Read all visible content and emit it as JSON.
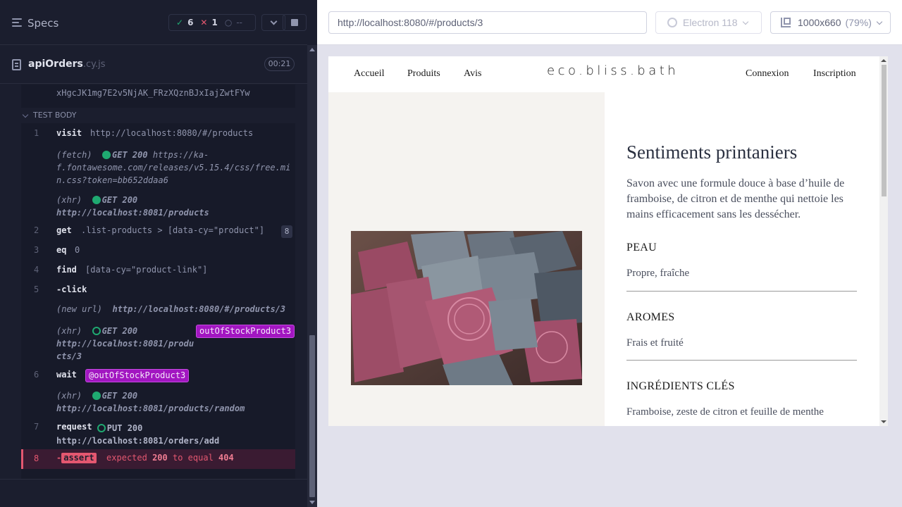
{
  "reporter": {
    "specs_label": "Specs",
    "stats": {
      "passed": "6",
      "failed": "1",
      "pending": "--"
    },
    "spec_file": {
      "name": "apiOrders",
      "ext": ".cy.js"
    },
    "duration": "00:21",
    "token_tail": "xHgcJK1mg7E2v5NjAK_FRzXQznBJxIajZwtFYw",
    "test_body_label": "TEST BODY",
    "commands": [
      {
        "num": "1",
        "name": "visit",
        "msg": "http://localhost:8080/#/products"
      },
      {
        "type": "(fetch)",
        "method": "GET 200",
        "url_lines": [
          "https://ka-",
          "f.fontawesome.com/releases/v5.15.4/css/free.mi",
          "n.css?token=bb652ddaa6"
        ]
      },
      {
        "type": "(xhr)",
        "method": "GET 200",
        "url": "http://localhost:8081/products"
      },
      {
        "num": "2",
        "name": "get",
        "msg": ".list-products > [data-cy=\"product\"]",
        "count": "8"
      },
      {
        "num": "3",
        "name": "eq",
        "msg": "0"
      },
      {
        "num": "4",
        "name": "find",
        "msg": "[data-cy=\"product-link\"]"
      },
      {
        "num": "5",
        "name": "-click"
      },
      {
        "type": "(new url)",
        "url": "http://localhost:8080/#/products/3"
      },
      {
        "type": "(xhr)",
        "method": "GET 200",
        "url_lines": [
          "http://localhost:8081/produ",
          "cts/3"
        ],
        "alias": "outOfStockProduct3"
      },
      {
        "num": "6",
        "name": "wait",
        "alias": "@outOfStockProduct3"
      },
      {
        "type": "(xhr)",
        "method": "GET 200",
        "url": "http://localhost:8081/products/random"
      },
      {
        "num": "7",
        "name": "request",
        "method": "PUT 200",
        "url": "http://localhost:8081/orders/add"
      },
      {
        "num": "8",
        "name": "-",
        "pill": "assert",
        "expected": "expected",
        "value": "200",
        "to_equal": "to equal",
        "target": "404"
      }
    ]
  },
  "browser": {
    "url": "http://localhost:8080/#/products/3",
    "name": "Electron 118",
    "viewport": "1000x660",
    "zoom": "(79%)"
  },
  "app": {
    "nav_left": [
      "Accueil",
      "Produits",
      "Avis"
    ],
    "logo": "eco.bliss.bath",
    "nav_right": [
      "Connexion",
      "Inscription"
    ],
    "product": {
      "title": "Sentiments printaniers",
      "description": "Savon avec une formule douce à base d’huile de framboise, de citron et de menthe qui nettoie les mains efficacement sans les dessécher.",
      "sections": [
        {
          "title": "PEAU",
          "value": "Propre, fraîche"
        },
        {
          "title": "AROMES",
          "value": "Frais et fruité"
        },
        {
          "title": "INGRÉDIENTS CLÉS",
          "value": "Framboise, zeste de citron et feuille de menthe"
        }
      ]
    }
  },
  "colors": {
    "reporter_bg": "#1b1e2e",
    "pass": "#1fa971",
    "fail": "#e45770",
    "alias": "#a216c1",
    "browser_bg": "#e1e1ec"
  }
}
